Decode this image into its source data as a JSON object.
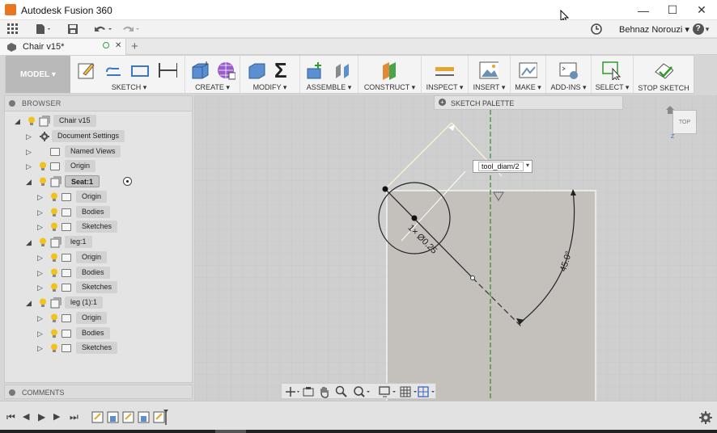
{
  "window": {
    "title": "Autodesk Fusion 360",
    "min_glyph": "—",
    "max_glyph": "☐",
    "close_glyph": "✕"
  },
  "app_toolbar": {
    "user_name": "Behnaz Norouzi",
    "user_caret": "▾",
    "help_glyph": "?",
    "help_caret": "▾",
    "grid_icon": "grid-icon",
    "file_icon": "file-icon",
    "save_icon": "save-icon",
    "undo_icon": "undo-icon",
    "redo_icon": "redo-icon",
    "history_icon": "clock-icon"
  },
  "doc_tab": {
    "label": "Chair v15*",
    "close_glyph": "✕",
    "new_tab_glyph": "+"
  },
  "ribbon": {
    "workspace": "MODEL",
    "workspace_caret": "▾",
    "groups": [
      {
        "id": "sketch",
        "label": "SKETCH ▾"
      },
      {
        "id": "create",
        "label": "CREATE ▾"
      },
      {
        "id": "modify",
        "label": "MODIFY ▾"
      },
      {
        "id": "assemble",
        "label": "ASSEMBLE ▾"
      },
      {
        "id": "construct",
        "label": "CONSTRUCT ▾"
      },
      {
        "id": "inspect",
        "label": "INSPECT ▾"
      },
      {
        "id": "insert",
        "label": "INSERT ▾"
      },
      {
        "id": "make",
        "label": "MAKE ▾"
      },
      {
        "id": "addins",
        "label": "ADD-INS ▾"
      },
      {
        "id": "select",
        "label": "SELECT ▾"
      },
      {
        "id": "stopsketch",
        "label": "STOP SKETCH"
      }
    ],
    "modify_glyph": "Σ"
  },
  "browser": {
    "title": "BROWSER",
    "items": [
      {
        "label": "Chair v15"
      },
      {
        "label": "Document Settings"
      },
      {
        "label": "Named Views"
      },
      {
        "label": "Origin"
      },
      {
        "label": "Seat:1"
      },
      {
        "label": "Origin"
      },
      {
        "label": "Bodies"
      },
      {
        "label": "Sketches"
      },
      {
        "label": "leg:1"
      },
      {
        "label": "Origin"
      },
      {
        "label": "Bodies"
      },
      {
        "label": "Sketches"
      },
      {
        "label": "leg (1):1"
      },
      {
        "label": "Origin"
      },
      {
        "label": "Bodies"
      },
      {
        "label": "Sketches"
      }
    ]
  },
  "comments": {
    "title": "COMMENTS"
  },
  "sketch_palette": {
    "title": "SKETCH PALETTE"
  },
  "viewcube": {
    "label": "TOP",
    "axis_z": "Z"
  },
  "canvas": {
    "dimension_input": "tool_diam/2",
    "dimension_caret": "▾",
    "circle_dim": "Ø0.25",
    "angle_dim": "45.0°",
    "dim_prefix": "1×"
  },
  "timeline": {
    "first_glyph": "⏮",
    "prev_glyph": "◀",
    "play_glyph": "▶",
    "next_glyph": "▶",
    "last_glyph": "⏭",
    "settings_icon": "gear-icon"
  }
}
